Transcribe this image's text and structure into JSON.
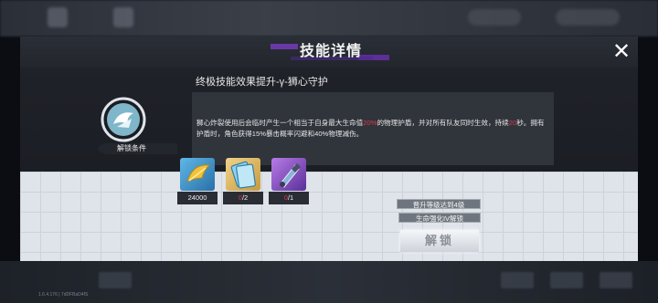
{
  "header": {
    "title": "技能详情",
    "close_icon": "close-icon"
  },
  "skill": {
    "name": "终极技能效果提升-γ-狮心守护",
    "description": {
      "p1": "狮心炸裂使用后会临时产生一个相当于自身最大生命值",
      "v1": "20%",
      "p2": "的物理护盾，并对所有队友同时生效，持续",
      "v2": "20",
      "p3": "秒。拥有护盾时，角色获得15%暴击概率闪避和40%物理减伤。"
    },
    "icon": "skill-emblem-icon"
  },
  "unlock": {
    "label": "解锁条件",
    "items": [
      {
        "icon": "gold-feather-icon",
        "count": "24000",
        "have": "",
        "need": ""
      },
      {
        "icon": "skill-card-icon",
        "count": "",
        "have": "0",
        "need": "/2"
      },
      {
        "icon": "purple-crystal-icon",
        "count": "",
        "have": "0",
        "need": "/1"
      }
    ],
    "conditions": [
      "晋升等级达到4级",
      "生命强化IV解锁"
    ],
    "button_label": "解锁"
  },
  "version_text": "1.6.4.176 | 7dDFBaD4fS",
  "colors": {
    "highlight": "#e0394b",
    "modal_dark": "#1f2228",
    "panel_light": "#dfe3ea"
  }
}
